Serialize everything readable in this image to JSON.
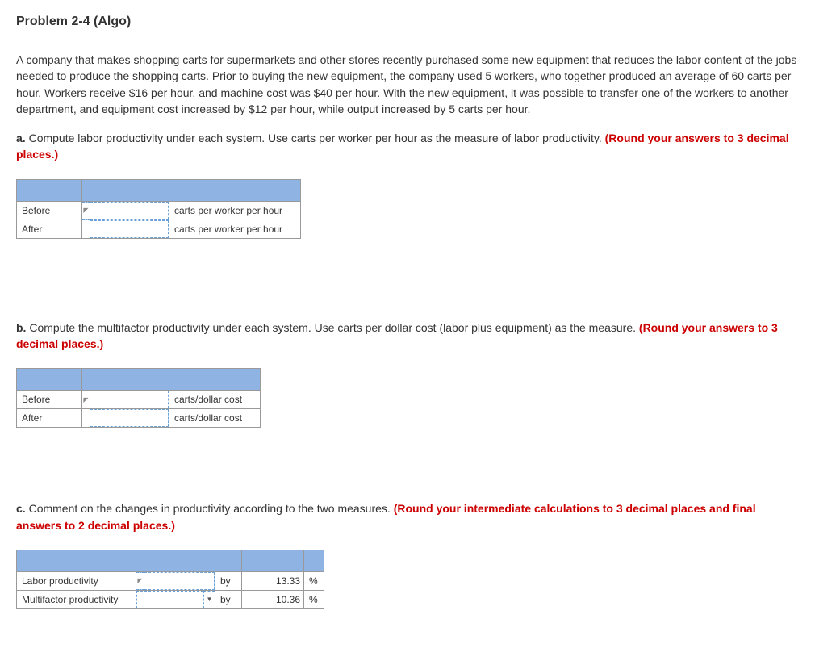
{
  "title": "Problem 2-4 (Algo)",
  "intro": "A company that makes shopping carts for supermarkets and other stores recently purchased some new equipment that reduces the labor content of the jobs needed to produce the shopping carts. Prior to buying the new equipment, the company used 5 workers, who together produced an average of 60 carts per hour. Workers receive $16 per hour, and machine cost was $40 per hour. With the new equipment, it was possible to transfer one of the workers to another department, and equipment cost increased by $12 per hour, while output increased by 5 carts per hour.",
  "partA": {
    "label": "a.",
    "text": " Compute labor productivity under each system. Use carts per worker per hour as the measure of labor productivity. ",
    "hint": "(Round your answers to 3 decimal places.)",
    "rows": [
      {
        "label": "Before",
        "unit": "carts per worker per hour"
      },
      {
        "label": "After",
        "unit": "carts per worker per hour"
      }
    ]
  },
  "partB": {
    "label": "b.",
    "text": " Compute the multifactor productivity under each system. Use carts per dollar cost (labor plus equipment) as the measure. ",
    "hint": "(Round your answers to 3 decimal places.)",
    "rows": [
      {
        "label": "Before",
        "unit": "carts/dollar cost"
      },
      {
        "label": "After",
        "unit": "carts/dollar cost"
      }
    ]
  },
  "partC": {
    "label": "c.",
    "text": " Comment on the changes in productivity according to the two measures. ",
    "hint": "(Round your intermediate calculations to 3 decimal places and final answers to 2 decimal places.)",
    "rows": [
      {
        "label": "Labor productivity",
        "by": "by",
        "value": "13.33",
        "pct": "%"
      },
      {
        "label": "Multifactor productivity",
        "by": "by",
        "value": "10.36",
        "pct": "%"
      }
    ]
  }
}
